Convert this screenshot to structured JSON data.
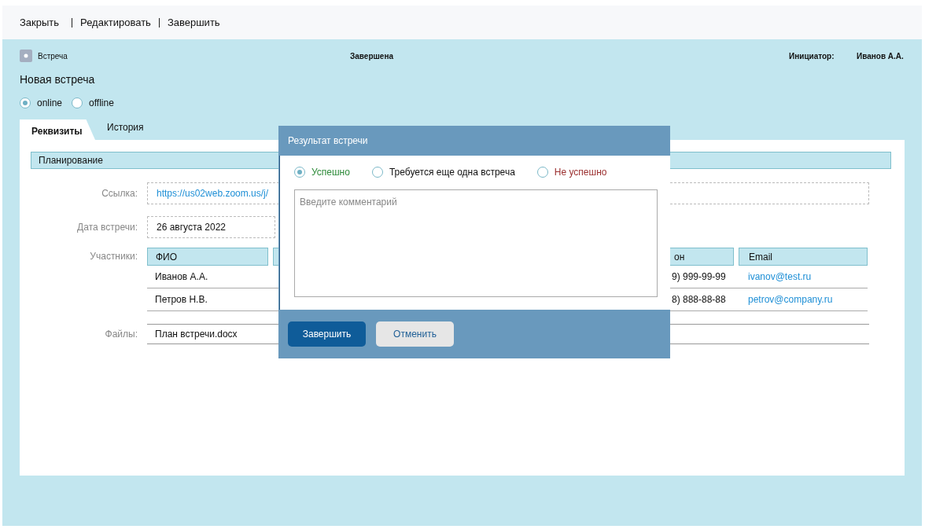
{
  "toolbar": {
    "actions": [
      "Закрыть",
      "Редактировать",
      "Завершить"
    ]
  },
  "header": {
    "type_label": "Встреча",
    "status": "Завершена",
    "initiator_label": "Инициатор:",
    "initiator": "Иванов А.А."
  },
  "title": "Новая встреча",
  "format": [
    {
      "label": "online",
      "selected": true
    },
    {
      "label": "offline",
      "selected": false
    }
  ],
  "tabs": [
    {
      "label": "Реквизиты",
      "selected": true
    },
    {
      "label": "История",
      "selected": false
    }
  ],
  "section": "Планирование",
  "link": {
    "label": "Ссылка:",
    "value": "https://us02web.zoom.us/j/"
  },
  "date": {
    "label": "Дата встречи:",
    "value": "26 августа 2022"
  },
  "participants": {
    "label": "Участники:",
    "columns": [
      "ФИО",
      "",
      "он",
      "Email"
    ],
    "rows": [
      [
        "Иванов А.А.",
        "",
        "9) 999-99-99",
        "ivanov@test.ru"
      ],
      [
        "Петров Н.В.",
        "",
        "8) 888-88-88",
        "petrov@company.ru"
      ]
    ]
  },
  "files": {
    "label": "Файлы:",
    "items": [
      "План встречи.docx"
    ]
  },
  "dialog": {
    "title": "Результат встречи",
    "options": [
      {
        "label": "Успешно",
        "selected": true,
        "color": "#2e8b3a"
      },
      {
        "label": "Требуется еще одна встреча",
        "selected": false,
        "color": "#111111"
      },
      {
        "label": "Не успешно",
        "selected": false,
        "color": "#9b2f2f"
      }
    ],
    "comment": {
      "placeholder": "Введите комментарий"
    },
    "buttons": [
      {
        "label": "Завершить",
        "kind": "primary"
      },
      {
        "label": "Отменить",
        "kind": "secondary"
      }
    ]
  }
}
